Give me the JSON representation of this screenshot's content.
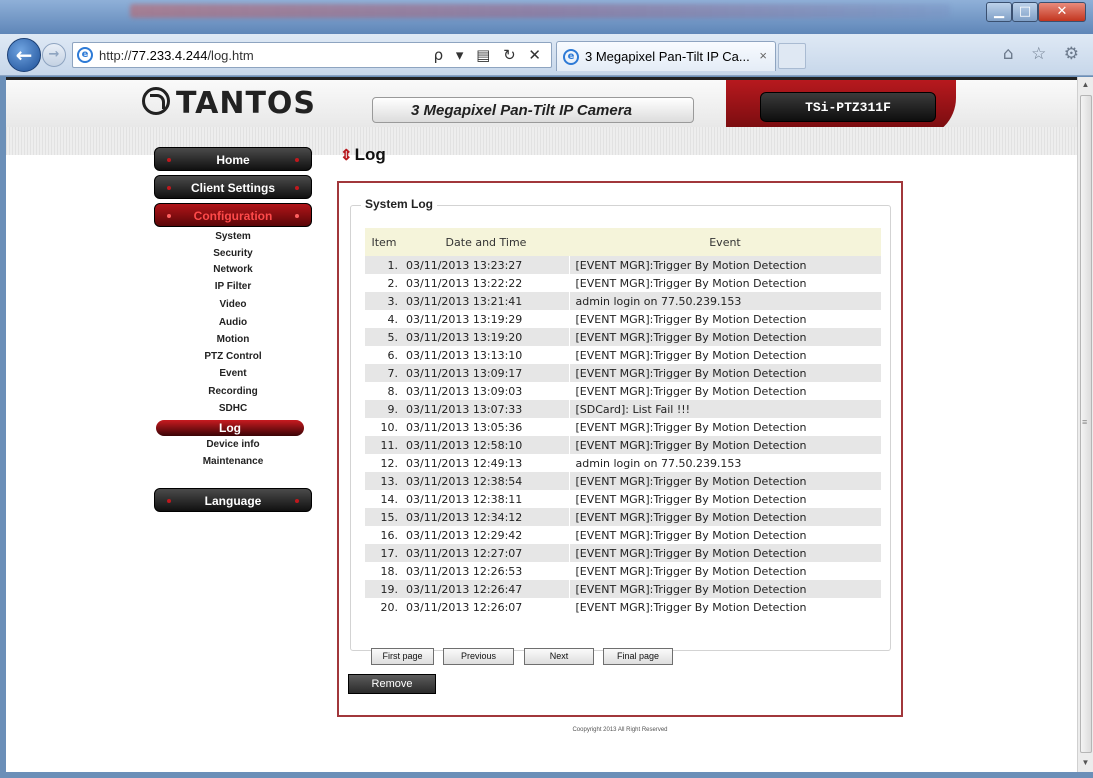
{
  "browser": {
    "url_prefix": "http://",
    "url_host": "77.233.4.244",
    "url_path": "/log.htm",
    "address_tools": "ρ ▾ ▤ ↻ ✕",
    "tab_title": "3 Megapixel Pan-Tilt IP Ca...",
    "tab_close": "×",
    "ie_glyph": "e",
    "right_icons": "⌂ ☆ ⚙",
    "min_glyph": "▁",
    "max_glyph": "□",
    "close_glyph": "✕",
    "back_glyph": "←",
    "forward_glyph": "→"
  },
  "header": {
    "brand": "TANTOS",
    "model_title": "3 Megapixel Pan-Tilt IP Camera",
    "model_code": "TSi-PTZ311F"
  },
  "menu": {
    "home": "Home",
    "client_settings": "Client Settings",
    "configuration": "Configuration",
    "language": "Language",
    "sub_items": [
      "System",
      "Security",
      "Network",
      "IP Filter",
      "Video",
      "Audio",
      "Motion",
      "PTZ Control",
      "Event",
      "Recording",
      "SDHC",
      "Log",
      "Device info",
      "Maintenance"
    ],
    "selected": "Log"
  },
  "content": {
    "page_title": "Log",
    "section_title": "System Log",
    "columns": {
      "item": "Item",
      "date": "Date and Time",
      "event": "Event"
    },
    "rows": [
      {
        "n": "1.",
        "date": "03/11/2013 13:23:27",
        "event": "[EVENT MGR]:Trigger By Motion Detection"
      },
      {
        "n": "2.",
        "date": "03/11/2013 13:22:22",
        "event": "[EVENT MGR]:Trigger By Motion Detection"
      },
      {
        "n": "3.",
        "date": "03/11/2013 13:21:41",
        "event": "admin login on 77.50.239.153"
      },
      {
        "n": "4.",
        "date": "03/11/2013 13:19:29",
        "event": "[EVENT MGR]:Trigger By Motion Detection"
      },
      {
        "n": "5.",
        "date": "03/11/2013 13:19:20",
        "event": "[EVENT MGR]:Trigger By Motion Detection"
      },
      {
        "n": "6.",
        "date": "03/11/2013 13:13:10",
        "event": "[EVENT MGR]:Trigger By Motion Detection"
      },
      {
        "n": "7.",
        "date": "03/11/2013 13:09:17",
        "event": "[EVENT MGR]:Trigger By Motion Detection"
      },
      {
        "n": "8.",
        "date": "03/11/2013 13:09:03",
        "event": "[EVENT MGR]:Trigger By Motion Detection"
      },
      {
        "n": "9.",
        "date": "03/11/2013 13:07:33",
        "event": "[SDCard]: List Fail !!!"
      },
      {
        "n": "10.",
        "date": "03/11/2013 13:05:36",
        "event": "[EVENT MGR]:Trigger By Motion Detection"
      },
      {
        "n": "11.",
        "date": "03/11/2013 12:58:10",
        "event": "[EVENT MGR]:Trigger By Motion Detection"
      },
      {
        "n": "12.",
        "date": "03/11/2013 12:49:13",
        "event": "admin login on 77.50.239.153"
      },
      {
        "n": "13.",
        "date": "03/11/2013 12:38:54",
        "event": "[EVENT MGR]:Trigger By Motion Detection"
      },
      {
        "n": "14.",
        "date": "03/11/2013 12:38:11",
        "event": "[EVENT MGR]:Trigger By Motion Detection"
      },
      {
        "n": "15.",
        "date": "03/11/2013 12:34:12",
        "event": "[EVENT MGR]:Trigger By Motion Detection"
      },
      {
        "n": "16.",
        "date": "03/11/2013 12:29:42",
        "event": "[EVENT MGR]:Trigger By Motion Detection"
      },
      {
        "n": "17.",
        "date": "03/11/2013 12:27:07",
        "event": "[EVENT MGR]:Trigger By Motion Detection"
      },
      {
        "n": "18.",
        "date": "03/11/2013 12:26:53",
        "event": "[EVENT MGR]:Trigger By Motion Detection"
      },
      {
        "n": "19.",
        "date": "03/11/2013 12:26:47",
        "event": "[EVENT MGR]:Trigger By Motion Detection"
      },
      {
        "n": "20.",
        "date": "03/11/2013 12:26:07",
        "event": "[EVENT MGR]:Trigger By Motion Detection"
      }
    ],
    "pager": {
      "first": "First page",
      "previous": "Previous",
      "next": "Next",
      "final": "Final page"
    },
    "remove_label": "Remove",
    "footer": "Coopyright 2013 All Right Reserved"
  },
  "colors": {
    "accent_red": "#b7191e",
    "menu_dark": "#101010",
    "row_stripe": "#e6e6e6",
    "header_yellow": "#f5f4da"
  }
}
